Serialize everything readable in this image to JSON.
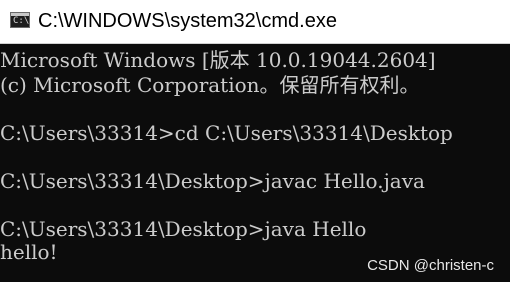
{
  "window": {
    "title": "C:\\WINDOWS\\system32\\cmd.exe",
    "icon": "cmd-console-icon"
  },
  "console": {
    "lines": [
      "Microsoft Windows [版本 10.0.19044.2604]",
      "(c) Microsoft Corporation。保留所有权利。",
      "C:\\Users\\33314>cd C:\\Users\\33314\\Desktop",
      "C:\\Users\\33314\\Desktop>javac Hello.java",
      "C:\\Users\\33314\\Desktop>java Hello",
      "hello!"
    ]
  },
  "watermark": "CSDN @christen-c",
  "colors": {
    "background": "#0c0c0c",
    "text": "#cccccc",
    "titlebar": "#ffffff"
  }
}
